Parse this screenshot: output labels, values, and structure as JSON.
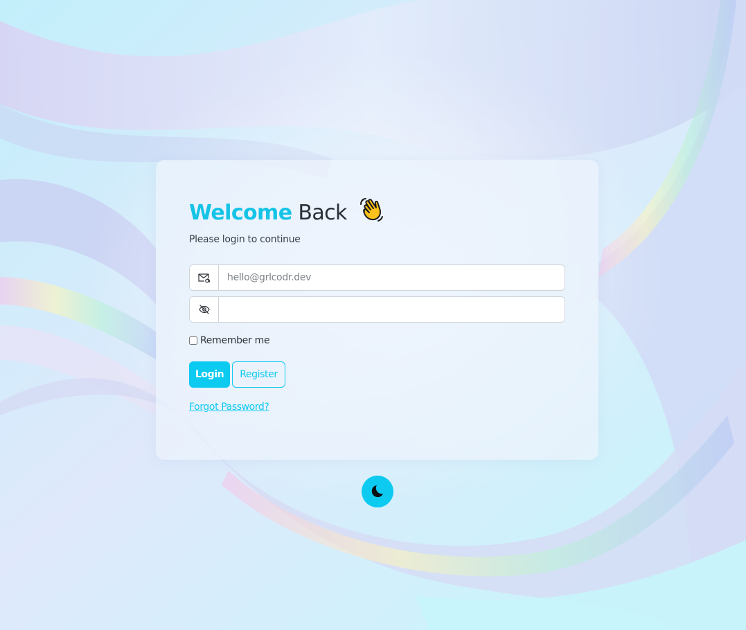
{
  "login": {
    "title_accent": "Welcome",
    "title_rest": "Back",
    "subtitle": "Please login to continue",
    "email": {
      "placeholder": "hello@grlcodr.dev",
      "value": "",
      "icon": "envelope-at-icon"
    },
    "password": {
      "placeholder": "",
      "value": "",
      "icon": "eye-slash-icon"
    },
    "remember_label": "Remember me",
    "remember_checked": false,
    "login_label": "Login",
    "register_label": "Register",
    "forgot_label": "Forgot Password?"
  },
  "theme_toggle": {
    "icon": "moon-icon"
  },
  "colors": {
    "accent": "#0dcaf0",
    "title_accent": "#14c3e6",
    "text": "#2a2f36",
    "input_border": "#ced4da",
    "background": "#bff6fb"
  }
}
